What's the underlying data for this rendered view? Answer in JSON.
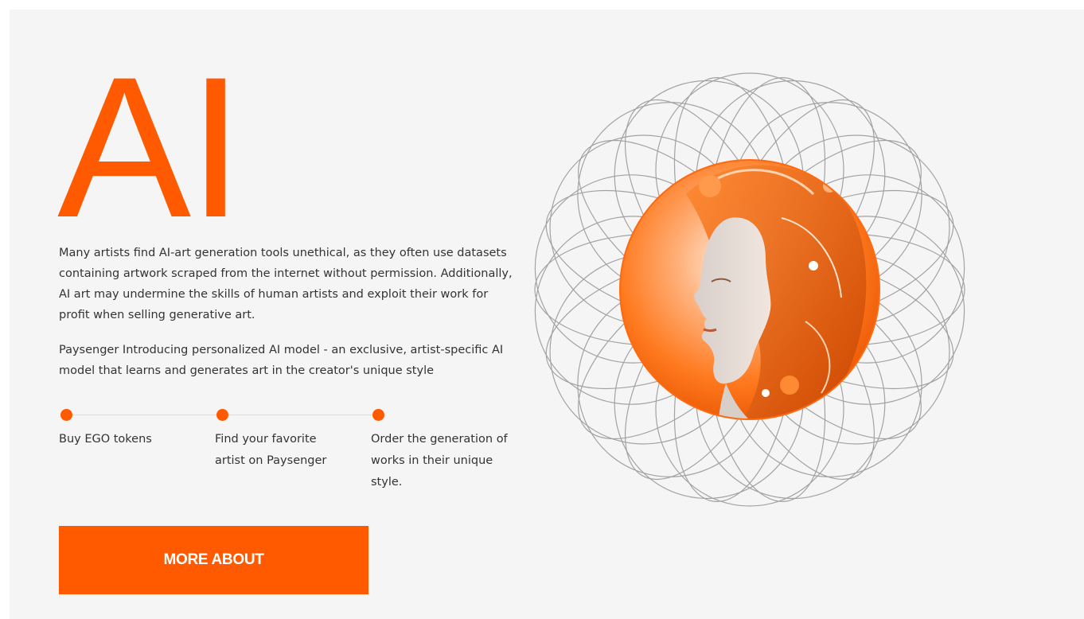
{
  "hero": {
    "title": "AI"
  },
  "content": {
    "paragraph_1": "Many artists find AI-art generation tools unethical, as they often use datasets containing artwork scraped from the internet without permission. Additionally, AI art may undermine the skills of human artists and exploit their work for profit when selling generative art.",
    "paragraph_2": "Paysenger Introducing personalized AI model - an exclusive, artist-specific AI model that learns and generates art in the creator's unique style"
  },
  "steps": [
    {
      "label": "Buy EGO tokens"
    },
    {
      "label": "Find your favorite artist on Paysenger"
    },
    {
      "label": "Order the generation of works in their unique style."
    }
  ],
  "cta": {
    "label": "MORE ABOUT"
  },
  "illustration": {
    "portrait": "orange-ai-woman-portrait",
    "pattern": "spirograph-ring"
  },
  "colors": {
    "accent": "#ff5a00",
    "background": "#f5f5f5",
    "text": "#333333",
    "pattern_stroke": "#9a9a9a"
  }
}
